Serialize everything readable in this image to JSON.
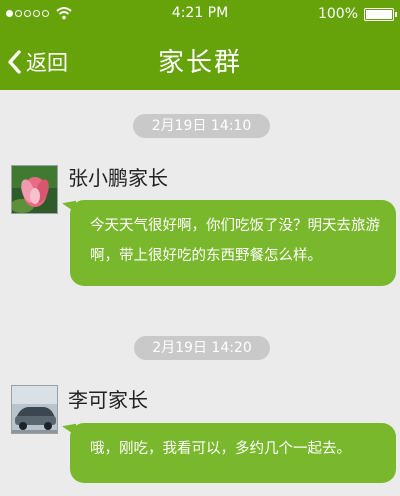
{
  "status_bar": {
    "time": "4:21 PM",
    "battery": "100%",
    "signal_filled": 1,
    "signal_total": 5
  },
  "header": {
    "back_label": "返回",
    "title": "家长群",
    "bg_color": "#66a30b"
  },
  "messages": [
    {
      "timestamp": "2月19日   14:10",
      "sender": "张小鹏家长",
      "avatar": "lotus-flower-avatar",
      "text": "今天天气很好啊，你们吃饭了没？明天去旅游啊，带上很好吃的东西野餐怎么样。"
    },
    {
      "timestamp": "2月19日   14:20",
      "sender": "李可家长",
      "avatar": "car-photo-avatar",
      "text": "哦，刚吃，我看可以，多约几个一起去。"
    }
  ],
  "colors": {
    "bubble": "#79b82c",
    "background": "#ebebeb",
    "time_pill": "#c9c9c9"
  }
}
